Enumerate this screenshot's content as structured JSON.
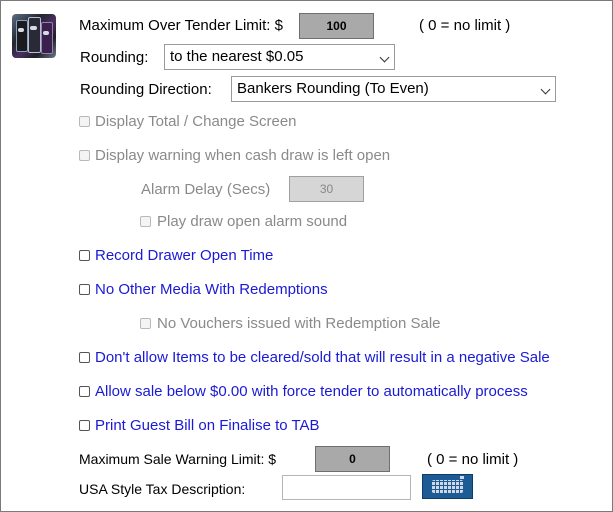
{
  "max_over_tender": {
    "label": "Maximum Over Tender Limit: $",
    "value": "100",
    "hint": "( 0 = no limit )"
  },
  "rounding": {
    "label": "Rounding:",
    "selected": "to the nearest $0.05"
  },
  "rounding_direction": {
    "label": "Rounding Direction:",
    "selected": "Bankers Rounding (To Even)"
  },
  "checkboxes": {
    "display_total": "Display Total / Change Screen",
    "cash_draw_warning": "Display warning when cash draw is left open",
    "play_alarm": "Play draw open alarm sound",
    "record_drawer": "Record Drawer Open Time",
    "no_other_media": "No Other Media With Redemptions",
    "no_vouchers": "No Vouchers issued with Redemption Sale",
    "negative_sale": "Don't allow Items to be cleared/sold that will result in a negative Sale",
    "sale_below_zero": "Allow sale below $0.00 with force tender to automatically process",
    "print_guest_bill": "Print Guest Bill on Finalise to TAB"
  },
  "alarm_delay": {
    "label": "Alarm Delay (Secs)",
    "value": "30"
  },
  "max_sale_warning": {
    "label": "Maximum Sale Warning Limit: $",
    "value": "0",
    "hint": "( 0 = no limit )"
  },
  "usa_tax": {
    "label": "USA Style Tax Description:",
    "value": ""
  },
  "colors": {
    "accent_text": "#1a1ad6",
    "disabled_text": "#8a8a8a",
    "field_bg": "#a9a9a9",
    "keyboard_button": "#1d5b95"
  },
  "icons": {
    "app_logo": "pos-app-logo-icon",
    "keyboard": "keyboard-icon"
  }
}
